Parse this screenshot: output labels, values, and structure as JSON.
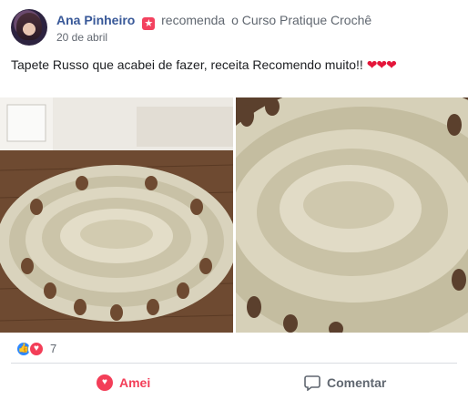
{
  "post": {
    "author": "Ana Pinheiro",
    "recommends": "recomenda",
    "of": "o",
    "page": "Curso Pratique Crochê",
    "date": "20 de abril",
    "text": "Tapete Russo que acabei de fazer, receita Recomendo muito!!",
    "emoji": "❤❤❤"
  },
  "reactions": {
    "count": "7",
    "types": [
      "like-icon",
      "love-icon"
    ]
  },
  "actions": {
    "love_label": "Amei",
    "comment_label": "Comentar"
  },
  "colors": {
    "link": "#385898",
    "love": "#f33e58",
    "like": "#2d88ff",
    "muted": "#606770"
  },
  "images": [
    {
      "name": "crochet-rug-photo-floor"
    },
    {
      "name": "crochet-rug-photo-closeup"
    }
  ]
}
